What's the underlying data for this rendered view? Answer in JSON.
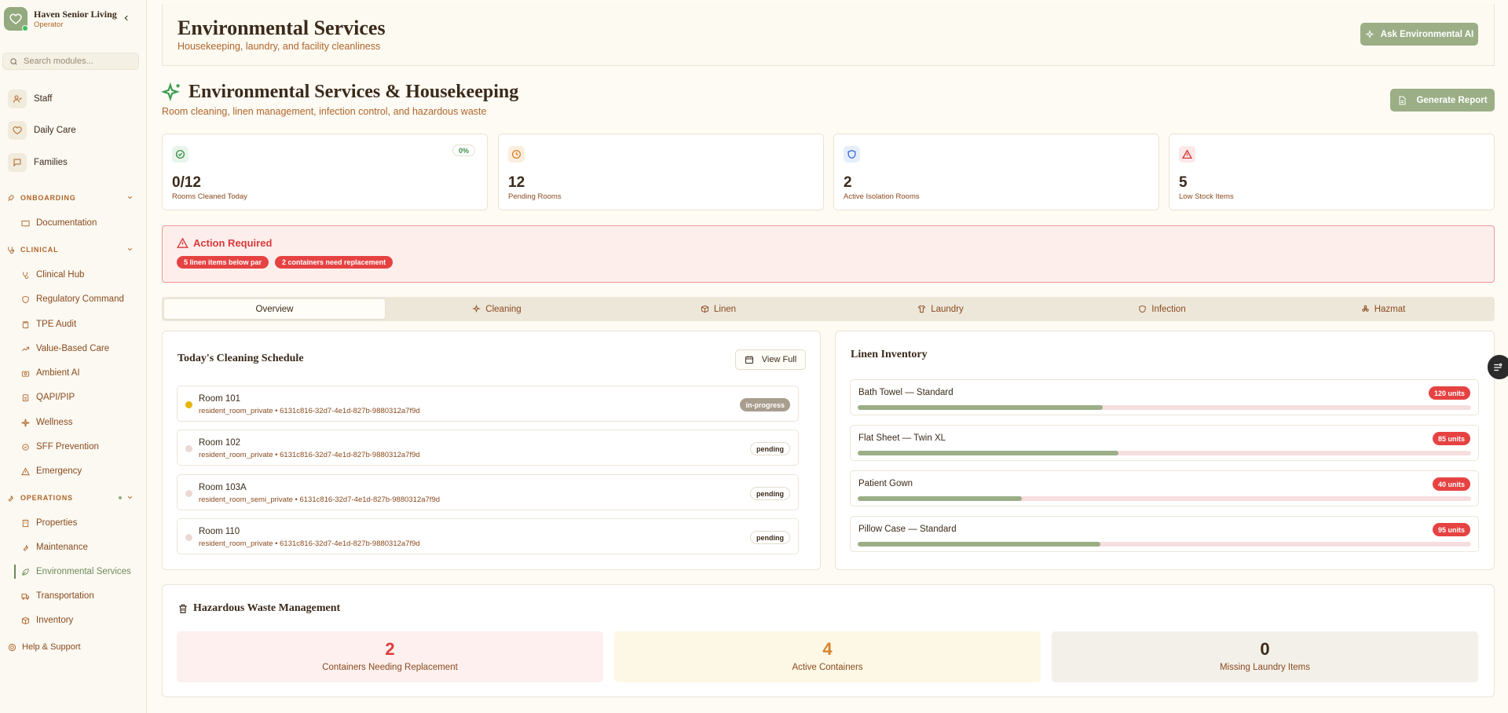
{
  "app": {
    "name": "Haven Senior Living",
    "role": "Operator",
    "brand_color": "#93a97e"
  },
  "search": {
    "placeholder": "Search modules..."
  },
  "sidebar": {
    "top_items": [
      {
        "label": "Staff",
        "icon": "user-icon"
      },
      {
        "label": "Daily Care",
        "icon": "heart-icon"
      },
      {
        "label": "Families",
        "icon": "message-icon"
      }
    ],
    "sections": [
      {
        "title": "ONBOARDING",
        "items": [
          {
            "label": "Documentation",
            "icon": "book-icon"
          }
        ]
      },
      {
        "title": "CLINICAL",
        "items": [
          {
            "label": "Clinical Hub",
            "icon": "stethoscope-icon"
          },
          {
            "label": "Regulatory Command",
            "icon": "shield-icon"
          },
          {
            "label": "TPE Audit",
            "icon": "clipboard-icon"
          },
          {
            "label": "Value-Based Care",
            "icon": "trending-icon"
          },
          {
            "label": "Ambient AI",
            "icon": "camera-icon"
          },
          {
            "label": "QAPI/PIP",
            "icon": "clipboard-icon"
          },
          {
            "label": "Wellness",
            "icon": "flower-icon"
          },
          {
            "label": "SFF Prevention",
            "icon": "badge-icon"
          },
          {
            "label": "Emergency",
            "icon": "alert-icon"
          }
        ]
      },
      {
        "title": "OPERATIONS",
        "items": [
          {
            "label": "Properties",
            "icon": "building-icon"
          },
          {
            "label": "Maintenance",
            "icon": "wrench-icon"
          },
          {
            "label": "Environmental Services",
            "icon": "leaf-icon",
            "active": true
          },
          {
            "label": "Transportation",
            "icon": "truck-icon"
          },
          {
            "label": "Inventory",
            "icon": "box-icon"
          }
        ]
      }
    ],
    "help": "Help & Support"
  },
  "header": {
    "title": "Environmental Services",
    "subtitle": "Housekeeping, laundry, and facility cleanliness",
    "ai_button": "Ask Environmental AI"
  },
  "page": {
    "title": "Environmental Services & Housekeeping",
    "subtitle": "Room cleaning, linen management, infection control, and hazardous waste",
    "report_button": "Generate Report"
  },
  "stats": [
    {
      "value": "0/12",
      "label": "Rooms Cleaned Today",
      "icon": "check-circle-icon",
      "badge": "0%",
      "color": "#3c8f4a"
    },
    {
      "value": "12",
      "label": "Pending Rooms",
      "icon": "clock-icon",
      "color": "#d9822b"
    },
    {
      "value": "2",
      "label": "Active Isolation Rooms",
      "icon": "shield-icon",
      "color": "#3b6fd4"
    },
    {
      "value": "5",
      "label": "Low Stock Items",
      "icon": "warning-icon",
      "color": "#d93a3a"
    }
  ],
  "alert": {
    "title": "Action Required",
    "badges": [
      "5 linen items below par",
      "2 containers need replacement"
    ]
  },
  "tabs": [
    {
      "label": "Overview",
      "icon": "",
      "active": true
    },
    {
      "label": "Cleaning",
      "icon": "sparkle-icon"
    },
    {
      "label": "Linen",
      "icon": "box-icon"
    },
    {
      "label": "Laundry",
      "icon": "shirt-icon"
    },
    {
      "label": "Infection",
      "icon": "shield-icon"
    },
    {
      "label": "Hazmat",
      "icon": "biohazard-icon"
    }
  ],
  "schedule": {
    "title": "Today's Cleaning Schedule",
    "view_full": "View Full",
    "rooms": [
      {
        "name": "Room 101",
        "detail": "resident_room_private • 6131c816-32d7-4e1d-827b-9880312a7f9d",
        "status": "in-progress",
        "dot": "#e5b40f"
      },
      {
        "name": "Room 102",
        "detail": "resident_room_private • 6131c816-32d7-4e1d-827b-9880312a7f9d",
        "status": "pending",
        "dot": "#ead9d4"
      },
      {
        "name": "Room 103A",
        "detail": "resident_room_semi_private • 6131c816-32d7-4e1d-827b-9880312a7f9d",
        "status": "pending",
        "dot": "#ead9d4"
      },
      {
        "name": "Room 110",
        "detail": "resident_room_private • 6131c816-32d7-4e1d-827b-9880312a7f9d",
        "status": "pending",
        "dot": "#ead9d4"
      }
    ]
  },
  "linen": {
    "title": "Linen Inventory",
    "items": [
      {
        "name": "Bath Towel — Standard",
        "units": "120 units",
        "level": 0.4
      },
      {
        "name": "Flat Sheet — Twin XL",
        "units": "85 units",
        "level": 0.425
      },
      {
        "name": "Patient Gown",
        "units": "40 units",
        "level": 0.267
      },
      {
        "name": "Pillow Case — Standard",
        "units": "95 units",
        "level": 0.396
      }
    ]
  },
  "hazmat": {
    "title": "Hazardous Waste Management",
    "boxes": [
      {
        "value": "2",
        "label": "Containers Needing Replacement",
        "color": "#e03c3c",
        "bg": "#fdf0ee"
      },
      {
        "value": "4",
        "label": "Active Containers",
        "color": "#d9822b",
        "bg": "#fdf8e6"
      },
      {
        "value": "0",
        "label": "Missing Laundry Items",
        "color": "#3b2a1a",
        "bg": "#f3f0e9"
      }
    ]
  }
}
